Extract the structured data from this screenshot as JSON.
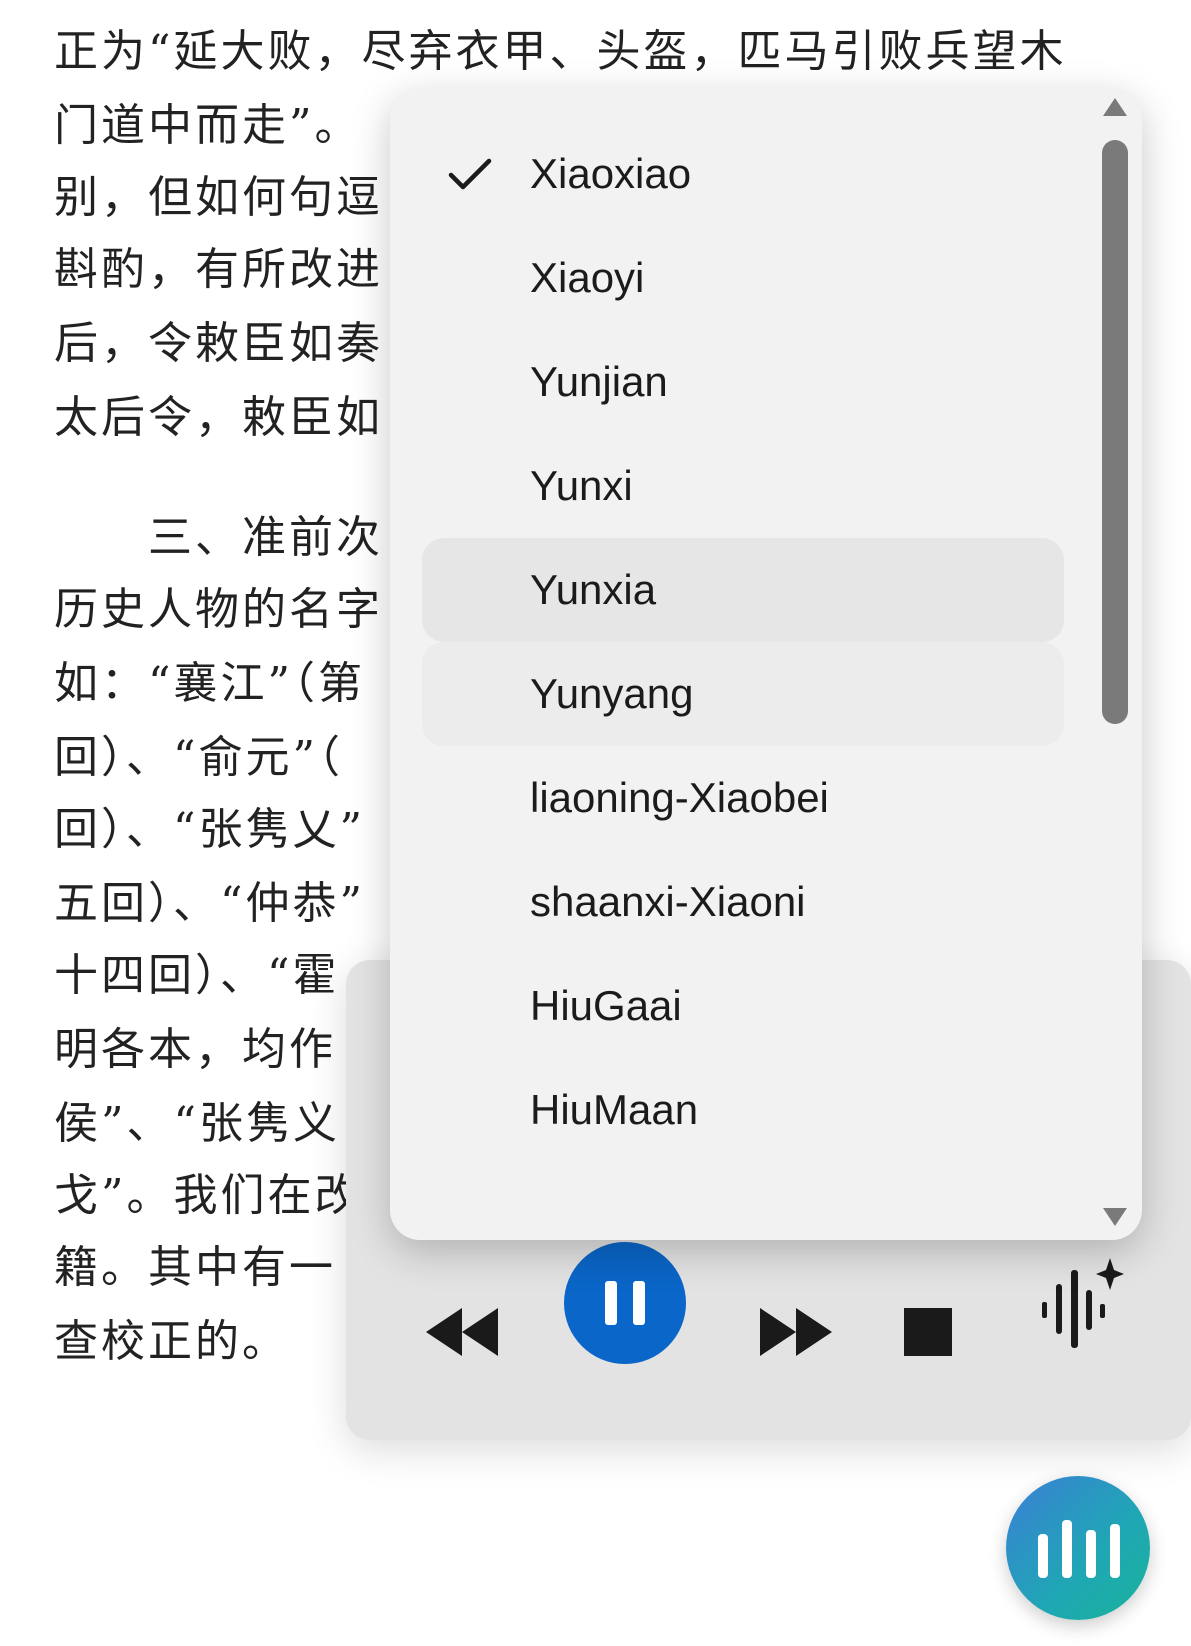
{
  "document": {
    "lines": [
      "正为“延大败，尽弃衣甲、头盔，匹马引败兵望木",
      "门道中而走”。",
      "别，但如何句逗",
      "斟酌，有所改进",
      "后，令敕臣如奏",
      "太后令，敕臣如",
      "三、准前次",
      "历史人物的名字",
      "如：“襄江”（第",
      "回）、“俞元”（",
      "回）、“张隽乂”",
      "五回）、“仲恭”",
      "十四回）、“霍",
      "明各本，均作",
      "侯”、“张隽义",
      "戈”。我们在改",
      "籍。其中有一",
      "查校正的。"
    ]
  },
  "voice_menu": {
    "selected": "Xiaoxiao",
    "items": [
      {
        "label": "Xiaoxiao",
        "checked": true
      },
      {
        "label": "Xiaoyi"
      },
      {
        "label": "Yunjian"
      },
      {
        "label": "Yunxi"
      },
      {
        "label": "Yunxia",
        "state": "hover"
      },
      {
        "label": "Yunyang",
        "state": "pressed"
      },
      {
        "label": "liaoning-Xiaobei"
      },
      {
        "label": "shaanxi-Xiaoni"
      },
      {
        "label": "HiuGaai"
      },
      {
        "label": "HiuMaan"
      }
    ],
    "scroll_up_icon": "triangle-up-icon",
    "scroll_down_icon": "triangle-down-icon"
  },
  "player": {
    "controls": [
      "rewind-icon",
      "pause-icon",
      "fast-forward-icon",
      "stop-icon",
      "voice-sparkle-icon"
    ],
    "accent_color": "#0a66c8"
  },
  "read_aloud_fab": {
    "icon": "audio-bars-icon"
  }
}
